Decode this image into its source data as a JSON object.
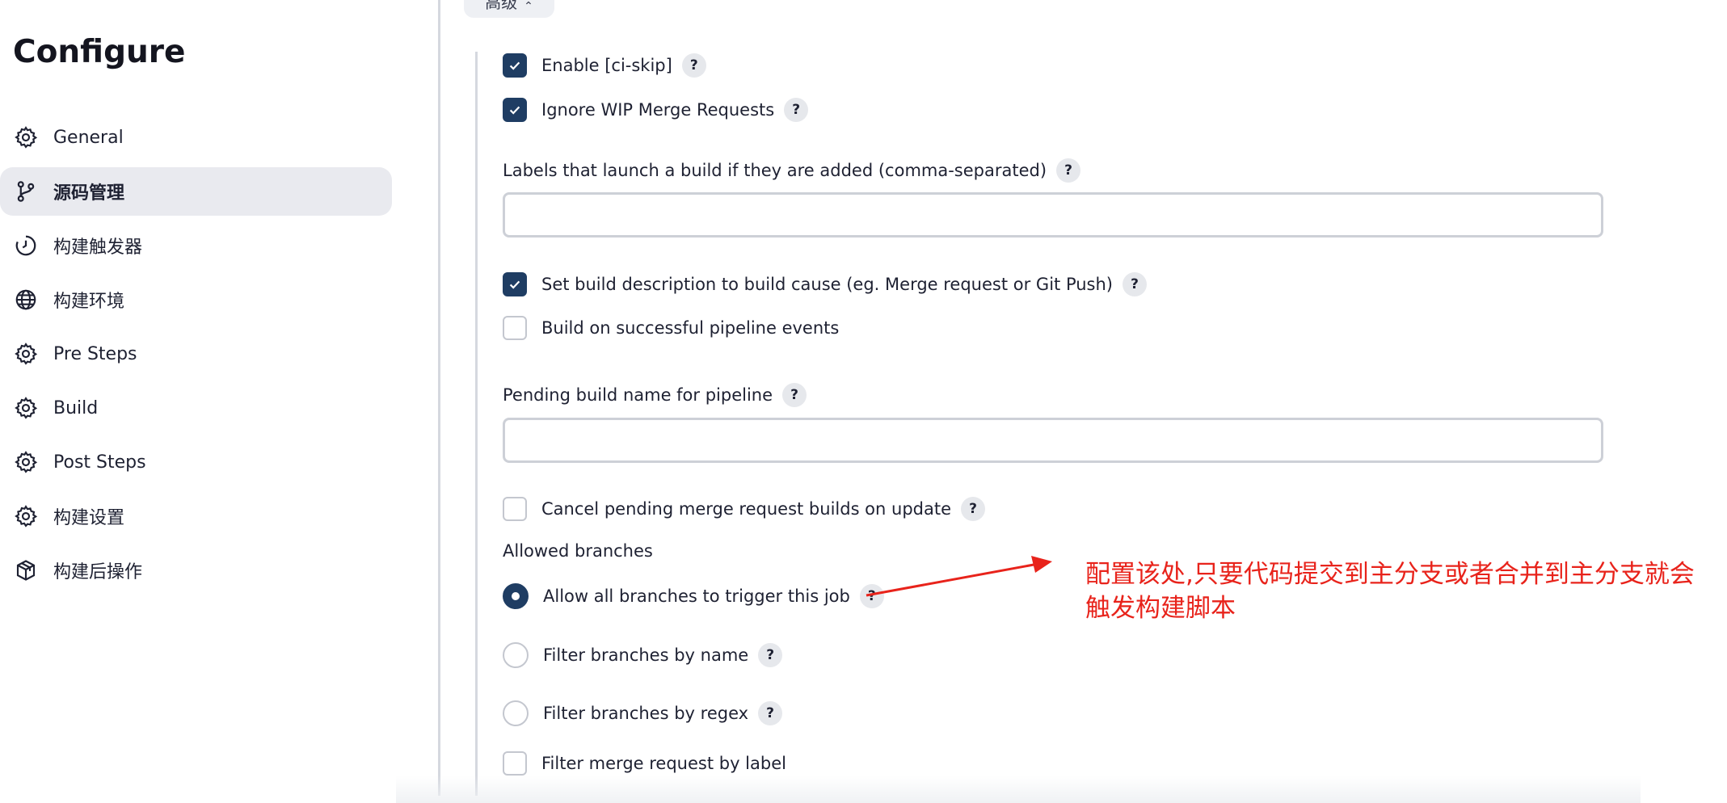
{
  "page": {
    "title": "Configure"
  },
  "sidebar": {
    "items": [
      {
        "label": "General",
        "icon": "gear-icon",
        "active": false
      },
      {
        "label": "源码管理",
        "icon": "branch-icon",
        "active": true
      },
      {
        "label": "构建触发器",
        "icon": "clock-icon",
        "active": false
      },
      {
        "label": "构建环境",
        "icon": "globe-icon",
        "active": false
      },
      {
        "label": "Pre Steps",
        "icon": "gear-icon",
        "active": false
      },
      {
        "label": "Build",
        "icon": "gear-icon",
        "active": false
      },
      {
        "label": "Post Steps",
        "icon": "gear-icon",
        "active": false
      },
      {
        "label": "构建设置",
        "icon": "gear-icon",
        "active": false
      },
      {
        "label": "构建后操作",
        "icon": "package-icon",
        "active": false
      }
    ]
  },
  "advanced": {
    "label": "高级"
  },
  "form": {
    "enable_ci_skip": {
      "label": "Enable [ci-skip]",
      "checked": true
    },
    "ignore_wip": {
      "label": "Ignore WIP Merge Requests",
      "checked": true
    },
    "labels_launch": {
      "label": "Labels that launch a build if they are added (comma-separated)",
      "value": ""
    },
    "set_build_desc": {
      "label": "Set build description to build cause (eg. Merge request or Git Push)",
      "checked": true
    },
    "build_on_pipeline": {
      "label": "Build on successful pipeline events",
      "checked": false
    },
    "pending_build_name": {
      "label": "Pending build name for pipeline",
      "value": ""
    },
    "cancel_pending": {
      "label": "Cancel pending merge request builds on update",
      "checked": false
    },
    "allowed_branches": {
      "label": "Allowed branches",
      "options": [
        {
          "label": "Allow all branches to trigger this job",
          "selected": true
        },
        {
          "label": "Filter branches by name",
          "selected": false
        },
        {
          "label": "Filter branches by regex",
          "selected": false
        }
      ]
    },
    "filter_mr_label": {
      "label": "Filter merge request by label",
      "checked": false
    },
    "help_label": "?"
  },
  "annotation": {
    "text_line1": "配置该处,只要代码提交到主分支或者合并到主分支就会",
    "text_line2": "触发构建脚本",
    "color": "#e8231b"
  },
  "colors": {
    "accent": "#1f3d63",
    "sidebar_active_bg": "#e9eaef"
  }
}
